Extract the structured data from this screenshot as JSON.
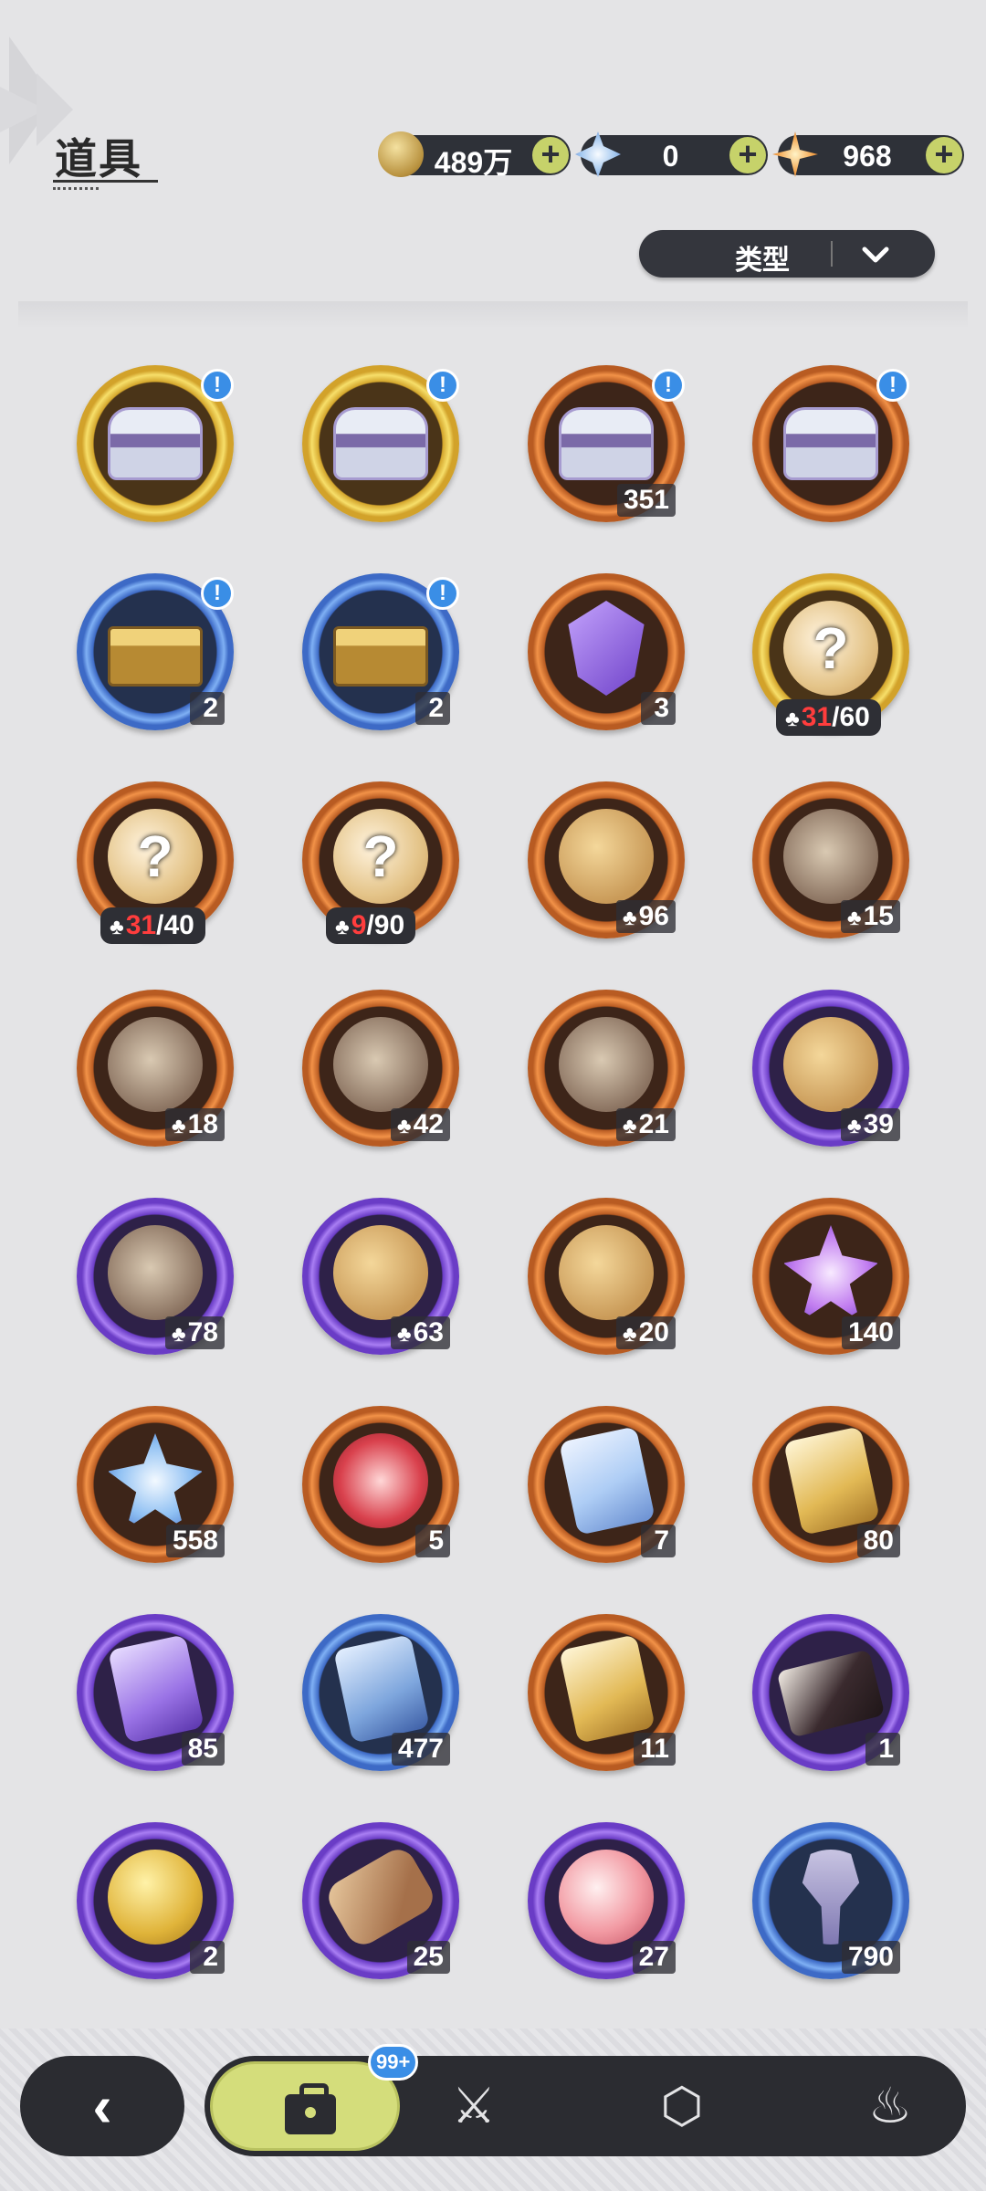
{
  "header": {
    "title": "道具"
  },
  "currencies": [
    {
      "name": "gold-coin-icon",
      "value": "489万",
      "add": "+"
    },
    {
      "name": "crystal-icon",
      "value": "0",
      "add": "+"
    },
    {
      "name": "star-gem-icon",
      "value": "968",
      "add": "+"
    }
  ],
  "filter": {
    "label": "类型",
    "icon": "chevron-down-icon"
  },
  "items": [
    {
      "frame": "gold",
      "pic": "chest",
      "count": "",
      "alert": "!"
    },
    {
      "frame": "gold",
      "pic": "chest",
      "count": "",
      "alert": "!"
    },
    {
      "frame": "orange",
      "pic": "chest",
      "count": "351",
      "alert": "!"
    },
    {
      "frame": "orange",
      "pic": "chest",
      "count": "",
      "alert": "!"
    },
    {
      "frame": "blue",
      "pic": "box",
      "count": "2",
      "alert": "!"
    },
    {
      "frame": "blue",
      "pic": "box",
      "count": "2",
      "alert": "!"
    },
    {
      "frame": "orange",
      "pic": "crystal",
      "count": "3",
      "alert": ""
    },
    {
      "frame": "gold",
      "pic": "puzzlebig",
      "q": "?",
      "fragments": {
        "owned": "31",
        "total": "/60"
      }
    },
    {
      "frame": "orange",
      "pic": "puzzlebig",
      "q": "?",
      "fragments": {
        "owned": "31",
        "total": "/40"
      }
    },
    {
      "frame": "orange",
      "pic": "puzzlebig",
      "q": "?",
      "fragments": {
        "owned": "9",
        "total": "/90"
      }
    },
    {
      "frame": "orange",
      "pic": "puzzle",
      "count": "96",
      "piece": true
    },
    {
      "frame": "orange",
      "pic": "mask",
      "count": "15",
      "piece": true
    },
    {
      "frame": "orange",
      "pic": "mask",
      "count": "18",
      "piece": true
    },
    {
      "frame": "orange",
      "pic": "mask",
      "count": "42",
      "piece": true
    },
    {
      "frame": "orange",
      "pic": "mask",
      "count": "21",
      "piece": true
    },
    {
      "frame": "purple",
      "pic": "puzzle",
      "count": "39",
      "piece": true
    },
    {
      "frame": "purple",
      "pic": "mask",
      "count": "78",
      "piece": true
    },
    {
      "frame": "purple",
      "pic": "puzzle",
      "count": "63",
      "piece": true
    },
    {
      "frame": "orange",
      "pic": "puzzle",
      "count": "20",
      "piece": true
    },
    {
      "frame": "orange",
      "pic": "star",
      "count": "140"
    },
    {
      "frame": "orange",
      "pic": "bstar",
      "count": "558"
    },
    {
      "frame": "orange",
      "pic": "paw",
      "count": "5"
    },
    {
      "frame": "orange",
      "pic": "cardh",
      "count": "7"
    },
    {
      "frame": "orange",
      "pic": "card",
      "count": "80"
    },
    {
      "frame": "purple",
      "pic": "cardp",
      "count": "85"
    },
    {
      "frame": "blue",
      "pic": "cardb",
      "count": "477"
    },
    {
      "frame": "orange",
      "pic": "card",
      "count": "11"
    },
    {
      "frame": "purple",
      "pic": "gift",
      "count": "1"
    },
    {
      "frame": "purple",
      "pic": "shell",
      "count": "2"
    },
    {
      "frame": "purple",
      "pic": "scroll",
      "count": "25"
    },
    {
      "frame": "purple",
      "pic": "apple",
      "count": "27"
    },
    {
      "frame": "blue",
      "pic": "shovel",
      "count": "790"
    }
  ],
  "nav": {
    "back": "‹",
    "badge": "99+",
    "tabs": [
      {
        "name": "bag-icon",
        "active": true
      },
      {
        "name": "hat-sword-icon",
        "glyph": "⚔"
      },
      {
        "name": "hexagon-icon",
        "glyph": "⬡"
      },
      {
        "name": "cake-icon",
        "glyph": "♨"
      }
    ]
  },
  "colors": {
    "accent": "#d4dd7b",
    "alert": "#3a8ee6",
    "fragment_owned": "#ff3d3d"
  }
}
